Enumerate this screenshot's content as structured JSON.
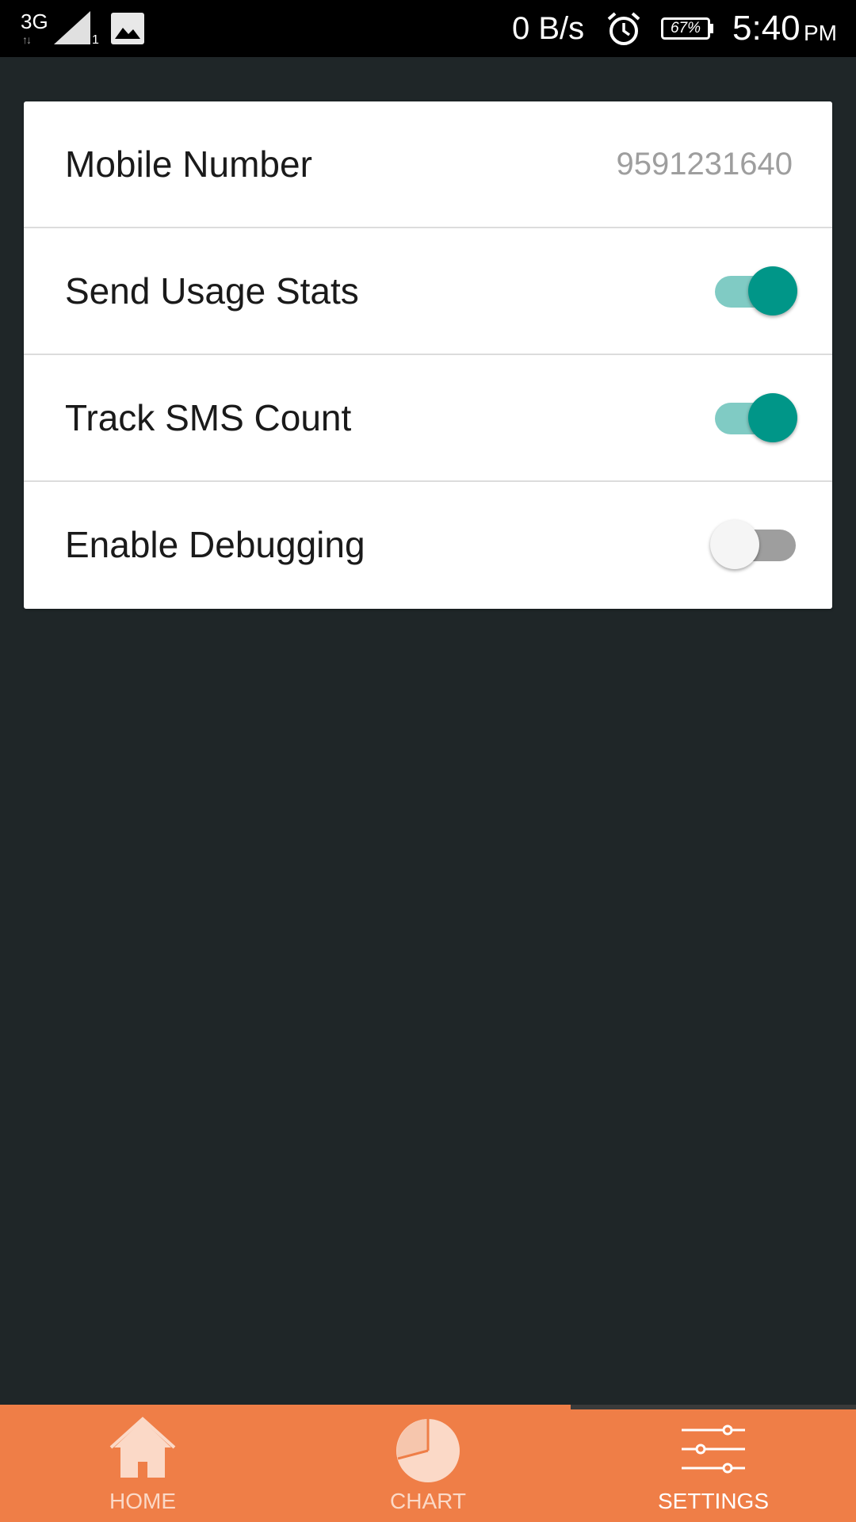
{
  "status_bar": {
    "network_type": "3G",
    "network_arrows": "↑↓",
    "sim_slot": "1",
    "data_speed": "0 B/s",
    "battery_percent": "67%",
    "time": "5:40",
    "ampm": "PM",
    "icons": [
      "signal-icon",
      "image-notification-icon",
      "alarm-icon",
      "battery-icon"
    ]
  },
  "settings": {
    "mobile_number": {
      "label": "Mobile Number",
      "value": "9591231640"
    },
    "send_usage_stats": {
      "label": "Send Usage Stats",
      "enabled": true
    },
    "track_sms_count": {
      "label": "Track SMS Count",
      "enabled": true
    },
    "enable_debugging": {
      "label": "Enable Debugging",
      "enabled": false
    }
  },
  "bottom_nav": {
    "items": [
      {
        "label": "HOME",
        "icon": "home-icon",
        "active": false
      },
      {
        "label": "CHART",
        "icon": "pie-chart-icon",
        "active": false
      },
      {
        "label": "SETTINGS",
        "icon": "sliders-icon",
        "active": true
      }
    ]
  },
  "colors": {
    "background": "#1f2628",
    "status_bar": "#000000",
    "card": "#ffffff",
    "toggle_on_thumb": "#009688",
    "toggle_on_track": "#80cbc4",
    "toggle_off_thumb": "#f5f5f5",
    "toggle_off_track": "#9e9e9e",
    "nav_background": "#ef7e47",
    "nav_inactive": "#fbd9c7",
    "nav_active": "#ffffff"
  }
}
